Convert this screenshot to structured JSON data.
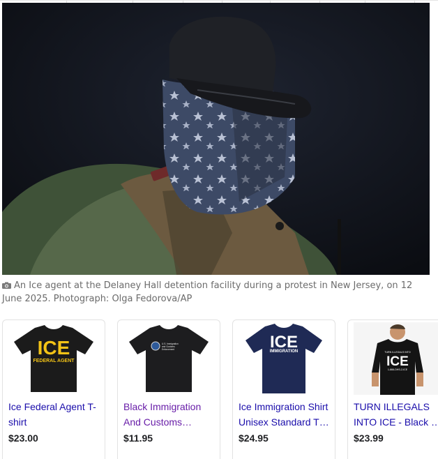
{
  "article": {
    "image_alt": "Masked agent in cap and tactical vest",
    "caption": "An Ice agent at the Delaney Hall detention facility during a protest in New Jersey, on 12 June 2025. Photograph: Olga Fedorova/AP",
    "caption_icon": "camera-icon"
  },
  "products": [
    {
      "title_line1": "Ice Federal Agent T-",
      "title_line2": "shirt",
      "price": "$23.00",
      "visited": false,
      "shirt_color": "#1b1b1b",
      "print": {
        "big": "ICE",
        "small": "FEDERAL AGENT",
        "color": "#f3c316"
      }
    },
    {
      "title_line1": "Black Immigration",
      "title_line2": "And Customs…",
      "price": "$11.95",
      "visited": true,
      "shirt_color": "#1d1d1f",
      "print": {
        "small": "U.S. Immigration and Customs Enforcement",
        "color": "#e8e8e8"
      }
    },
    {
      "title_line1": "Ice Immigration Shirt",
      "title_line2": "Unisex Standard T…",
      "price": "$24.95",
      "visited": false,
      "shirt_color": "#1f2a55",
      "print": {
        "big": "ICE",
        "small": "IMMIGRATION",
        "color": "#ffffff"
      }
    },
    {
      "title_line1": "TURN ILLEGALS",
      "title_line2": "INTO ICE - Black …",
      "price": "$23.99",
      "visited": false,
      "shirt_color": "#141414",
      "print": {
        "big": "ICE",
        "top": "TURN ILLEGALS INTO",
        "small": "1-866-DHS-2-ICE",
        "color": "#ffffff"
      }
    }
  ]
}
